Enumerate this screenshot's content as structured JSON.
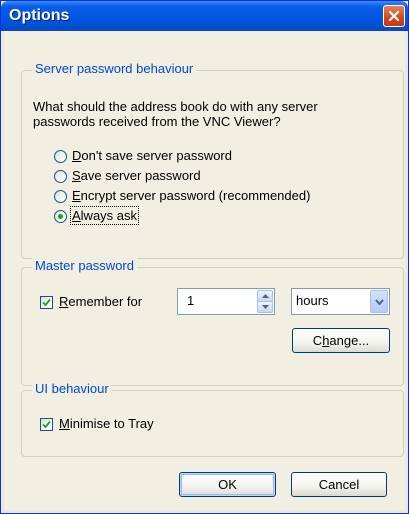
{
  "window": {
    "title": "Options"
  },
  "server_group": {
    "title": "Server password behaviour",
    "question_line1": "What should the address book do with any server",
    "question_line2": "passwords received from the VNC Viewer?",
    "options": [
      {
        "mnemonic": "D",
        "rest": "on't save server password",
        "checked": false
      },
      {
        "mnemonic": "S",
        "rest": "ave server password",
        "checked": false
      },
      {
        "mnemonic": "E",
        "rest": "ncrypt server password (recommended)",
        "checked": false
      },
      {
        "mnemonic": "A",
        "rest": "lways ask",
        "checked": true
      }
    ]
  },
  "master_group": {
    "title": "Master password",
    "remember_mnemonic": "R",
    "remember_rest": "emember for",
    "remember_checked": true,
    "duration_value": "1",
    "unit_value": "hours",
    "change_pre": "C",
    "change_mnemonic": "h",
    "change_post": "ange..."
  },
  "ui_group": {
    "title": "UI behaviour",
    "minimise_mnemonic": "M",
    "minimise_rest": "inimise to Tray",
    "minimise_checked": true
  },
  "buttons": {
    "ok": "OK",
    "cancel": "Cancel"
  },
  "icons": [
    "close-icon",
    "checkmark-icon",
    "spin-up-icon",
    "spin-down-icon",
    "dropdown-arrow-icon"
  ]
}
